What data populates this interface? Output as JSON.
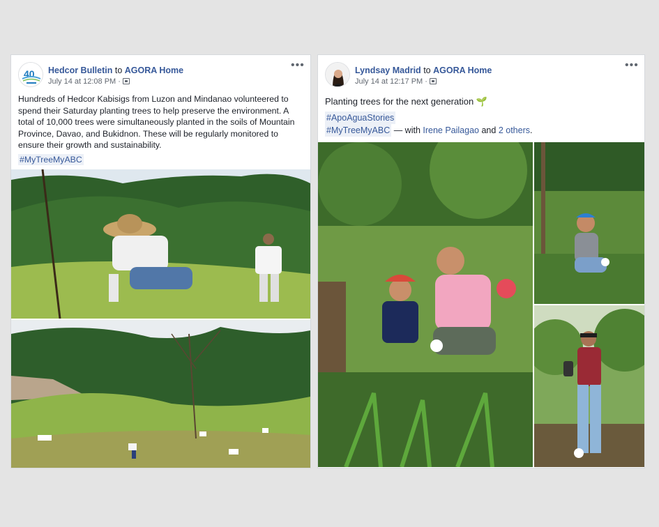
{
  "posts": [
    {
      "author": "Hedcor Bulletin",
      "to_word": "to",
      "group": "AGORA Home",
      "timestamp": "July 14 at 12:08 PM",
      "meta_separator": "·",
      "more_label": "•••",
      "avatar_icon": "hedcor-40-logo",
      "text": "Hundreds of Hedcor Kabisigs from Luzon and Mindanao volunteered to spend their Saturday planting trees to help preserve the environment. A total of 10,000 trees were simultaneously planted in the soils of Mountain Province, Davao, and Bukidnon. These will be regularly monitored to ensure their growth and sustainability.",
      "hashtag": "#MyTreeMyABC",
      "photos": [
        "volunteer-planting-photo",
        "hillside-planting-photo"
      ]
    },
    {
      "author": "Lyndsay Madrid",
      "to_word": "to",
      "group": "AGORA Home",
      "timestamp": "July 14 at 12:17 PM",
      "meta_separator": "·",
      "more_label": "•••",
      "avatar_icon": "profile-photo",
      "text": "Planting trees for the next generation",
      "text_emoji": "🌱",
      "hashtag1": "#ApoAguaStories",
      "hashtag2": "#MyTreeMyABC",
      "with_text": " — with ",
      "tagged_person": "Irene Pailagao",
      "and_text": " and ",
      "others_link": "2 others",
      "end_punct": ".",
      "photos": [
        "mother-child-planting-photo",
        "woman-planting-photo",
        "man-with-seedling-photo"
      ]
    }
  ],
  "colors": {
    "link": "#365899",
    "hashtag_bg": "#ecf0f7",
    "text": "#1d2129",
    "meta": "#616770",
    "page_bg": "#e4e4e4"
  }
}
